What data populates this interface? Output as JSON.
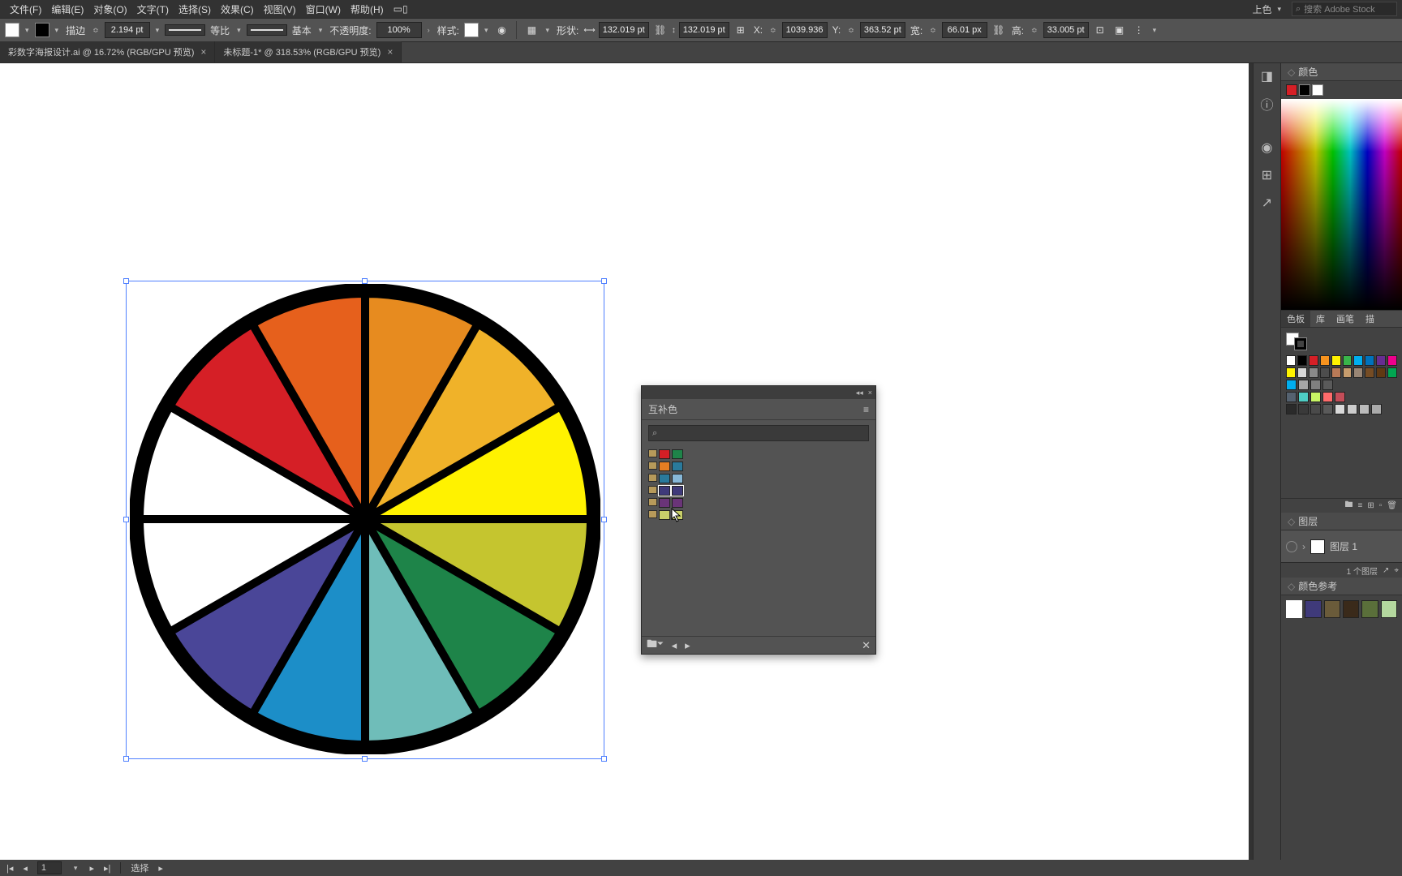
{
  "menu": {
    "items": [
      "文件(F)",
      "编辑(E)",
      "对象(O)",
      "文字(T)",
      "选择(S)",
      "效果(C)",
      "视图(V)",
      "窗口(W)",
      "帮助(H)"
    ],
    "layout_icon": "layout-icon"
  },
  "menubar_right": {
    "workspace": "上色",
    "search_placeholder": "搜索 Adobe Stock"
  },
  "options": {
    "stroke_label": "描边",
    "stroke_weight": "2.194 pt",
    "uniform_label": "等比",
    "basic_label": "基本",
    "opacity_label": "不透明度:",
    "opacity_value": "100%",
    "style_label": "样式:",
    "shape_label": "形状:",
    "w": "132.019 pt",
    "h": "132.019 pt",
    "x_label": "X:",
    "x": "1039.936",
    "y_label": "Y:",
    "y": "363.52 pt",
    "w2_label": "宽:",
    "w2": "66.01 px",
    "h2_label": "高:",
    "h2": "33.005 pt"
  },
  "tabs": [
    {
      "label": "彩数字海报设计.ai @ 16.72% (RGB/GPU 预览)"
    },
    {
      "label": "未标题-1* @ 318.53% (RGB/GPU 预览)"
    }
  ],
  "float_panel": {
    "title": "互补色",
    "rows": [
      [
        "#d51f26",
        "#1e8449"
      ],
      [
        "#e67e22",
        "#2a7a9c"
      ],
      [
        "#2a7a9c",
        "#87b8d8"
      ],
      [
        "#3f3a7a",
        "#3f3a7a"
      ],
      [
        "#6a3478",
        "#6a3478"
      ],
      [
        "#c8cf6a",
        "#c8cf6a"
      ]
    ],
    "selected_row": 3
  },
  "panels": {
    "color_title": "颜色",
    "swatches_tabs": [
      "色板",
      "库",
      "画笔",
      "描"
    ],
    "swatches": {
      "row1": [
        "#ffffff",
        "#000000",
        "#d51f26",
        "#f7931e",
        "#fff200",
        "#39b54a",
        "#00aeef",
        "#0072bc",
        "#662d91",
        "#ec008c"
      ],
      "row2": [
        "#fff200",
        "#d7d7d7",
        "#898989",
        "#4d4d4d",
        "#b97a57",
        "#c69c6d",
        "#998675",
        "#754c24",
        "#603913",
        "#00a651"
      ],
      "row3": [
        "#00aeef",
        "#a6a6a6",
        "#808080",
        "#5a5a5a"
      ],
      "row4": [
        "#556270",
        "#4ecdc4",
        "#c7f464",
        "#ff6b6b",
        "#c44d58"
      ],
      "row5": [
        "#2a2a2a",
        "#3a3a3a",
        "#4a4a4a",
        "#5a5a5a",
        "#dadada",
        "#cccccc",
        "#bbbbbb",
        "#aaaaaa"
      ]
    },
    "layers_title": "图层",
    "layer_name": "图层 1",
    "layers_footer": "1 个图层",
    "colorguide_title": "颜色参考",
    "colorguide": [
      "#3f3a7a",
      "#6a5b3a",
      "#3a2a1a",
      "#5a6f3a",
      "#b4d89e"
    ]
  },
  "status": {
    "page": "1",
    "tool": "选择"
  },
  "wheel_colors": [
    "#e78b1f",
    "#f0b229",
    "#fff200",
    "#c5c52f",
    "#1e8449",
    "#6fbdb9",
    "#1c8ec8",
    "#4a4698",
    "#ffffff",
    "#ffffff",
    "#d51f26",
    "#e6601c"
  ]
}
